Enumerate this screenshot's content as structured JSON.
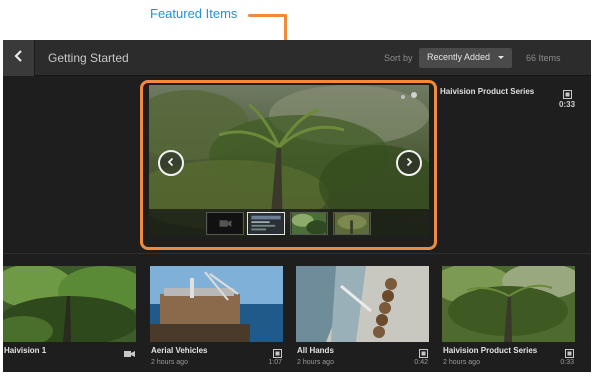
{
  "annotation": {
    "label": "Featured Items"
  },
  "colors": {
    "accent": "#f08a3c",
    "annotation_text": "#2b8fd6",
    "background": "#1e1e1e",
    "topbar": "#2c2c2c"
  },
  "header": {
    "back_icon": "chevron-left-icon",
    "title": "Getting Started",
    "sort_label": "Sort by",
    "sort_value": "Recently Added",
    "item_count": "66 Items"
  },
  "featured": {
    "prev_icon": "chevron-left-circle-icon",
    "next_icon": "chevron-right-circle-icon",
    "thumbnail_count_note": "4",
    "active_thumbnail": 2
  },
  "side_item": {
    "title": "Haivision Product Series",
    "duration": "0:33",
    "type_icon": "film-icon"
  },
  "grid": [
    {
      "title": "Haivision 1",
      "meta": "",
      "duration": "",
      "type_icon": "camera-icon"
    },
    {
      "title": "Aerial Vehicles",
      "meta": "2 hours ago",
      "duration": "1:07",
      "type_icon": "film-icon"
    },
    {
      "title": "All Hands",
      "meta": "2 hours ago",
      "duration": "0:42",
      "type_icon": "film-icon"
    },
    {
      "title": "Haivision Product Series",
      "meta": "2 hours ago",
      "duration": "0:33",
      "type_icon": "film-icon"
    }
  ]
}
